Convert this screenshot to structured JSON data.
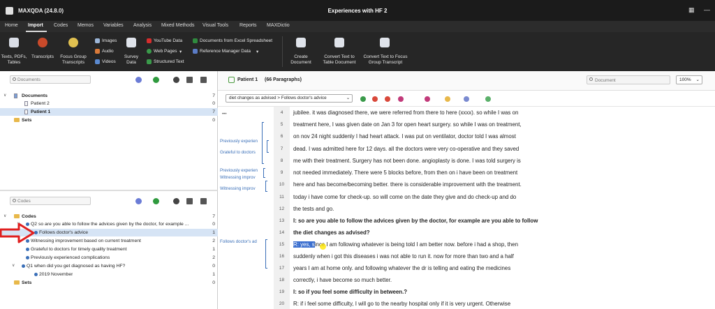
{
  "app": {
    "title": "MAXQDA (24.8.0)",
    "document_title": "Experiences with HF 2"
  },
  "menu": [
    "Home",
    "Import",
    "Codes",
    "Memos",
    "Variables",
    "Analysis",
    "Mixed Methods",
    "Visual Tools",
    "Reports",
    "MAXDictio"
  ],
  "ribbon": {
    "texts_pdfs": "Texts, PDFs, Tables",
    "transcripts": "Transcripts",
    "focus_group": "Focus Group Transcripts",
    "images": "Images",
    "audio": "Audio",
    "videos": "Videos",
    "survey": "Survey Data",
    "youtube": "YouTube Data",
    "webpages": "Web Pages",
    "structured": "Structured Text",
    "excel": "Documents from Excel Spreadsheet",
    "refmgr": "Reference Manager Data",
    "create_doc": "Create Document",
    "convert_table": "Convert Text to Table Document",
    "convert_focus": "Convert Text to Focus Group Transcript"
  },
  "documents": {
    "search_placeholder": "Documents",
    "root_label": "Documents",
    "root_count": "7",
    "items": [
      {
        "label": "Patient 2",
        "count": "0"
      },
      {
        "label": "Patient 1",
        "count": "7"
      }
    ],
    "sets_label": "Sets",
    "sets_count": "0"
  },
  "codes": {
    "search_placeholder": "Codes",
    "root_label": "Codes",
    "root_count": "7",
    "items": [
      {
        "label": "Q2 so are you able to follow the advices given by the doctor, for example ...",
        "count": "0"
      },
      {
        "label": "Follows doctor's advice",
        "count": "1"
      },
      {
        "label": "Witnessing improvement based on current treatment",
        "count": "2"
      },
      {
        "label": "Grateful to doctors for timely quality treatment",
        "count": "1"
      },
      {
        "label": "Previously experienced complications",
        "count": "2"
      },
      {
        "label": "Q1 when did you get diagnosed as having HF?",
        "count": "0"
      },
      {
        "label": "2019 November",
        "count": "1"
      }
    ],
    "sets_label": "Sets",
    "sets_count": "0"
  },
  "document_view": {
    "name": "Patient 1",
    "paragraphs": "(66 Paragraphs)",
    "search_placeholder": "Document",
    "zoom": "100%",
    "code_select": "diet changes as advised > Follows doctor's advice",
    "ellipsis": "•••",
    "lines": [
      {
        "n": "4",
        "text": "jubilee. it was diagnosed there, we were referred from there to here (xxxx). so while I was on",
        "bold": false
      },
      {
        "n": "5",
        "text": "treatment here, I was given date on Jan 3 for open heart surgery. so while I was on treatment,",
        "bold": false
      },
      {
        "n": "6",
        "text": "on nov 24 night suddenly I had heart attack. I was put on ventilator, doctor told I was almost",
        "bold": false
      },
      {
        "n": "7",
        "text": "dead. I was admitted here for 12 days. all the doctors were very co-operative and they saved",
        "bold": false
      },
      {
        "n": "8",
        "text": "me with their treatment. Surgery has not been done. angioplasty is done. I was told surgery is",
        "bold": false
      },
      {
        "n": "9",
        "text": "not needed immediately. There were 5 blocks before, from then on i have been on treatment",
        "bold": false
      },
      {
        "n": "10",
        "text": "here and has become/becoming better. there is considerable improvement with the treatment.",
        "bold": false
      },
      {
        "n": "11",
        "text": "today i have come for check-up. so will come on the date they give and do check-up and do",
        "bold": false
      },
      {
        "n": "12",
        "text": "the tests and go.",
        "bold": false
      },
      {
        "n": "13",
        "text": "I: so are you able to follow the advices given by the doctor, for example are you able to follow",
        "bold": true
      },
      {
        "n": "14",
        "text": "the diet changes as advised?",
        "bold": true
      },
      {
        "n": "15",
        "text_hl": "R: yes, s",
        "text": "ince I am following whatever is being told I am better now. before i had a shop, then",
        "bold": false
      },
      {
        "n": "16",
        "text": "suddenly when i got this diseases i was not able to run it. now for more than two and a half",
        "bold": false
      },
      {
        "n": "17",
        "text": "years I am at home only. and following whatever the dr is telling and eating the medicines",
        "bold": false
      },
      {
        "n": "18",
        "text": "correctly, i have become so much better.",
        "bold": false
      },
      {
        "n": "19",
        "text": "I: so if you feel some difficulty in between.?",
        "bold": true
      },
      {
        "n": "20",
        "text": "R: if i feel some difficulty, I will go to the nearby hospital only if it is very urgent. Otherwise",
        "bold": false
      }
    ],
    "margin_codes": [
      "Previously experien",
      "Grateful to doctors",
      "Previously experien",
      "Witnessing improv",
      "Witnessing improv",
      "Follows doctor's ad"
    ]
  },
  "colors": {
    "accent": "#3a6fb8",
    "highlight": "#3b6fcf",
    "selection": "#d6e4f5",
    "arrow": "#e02020"
  }
}
